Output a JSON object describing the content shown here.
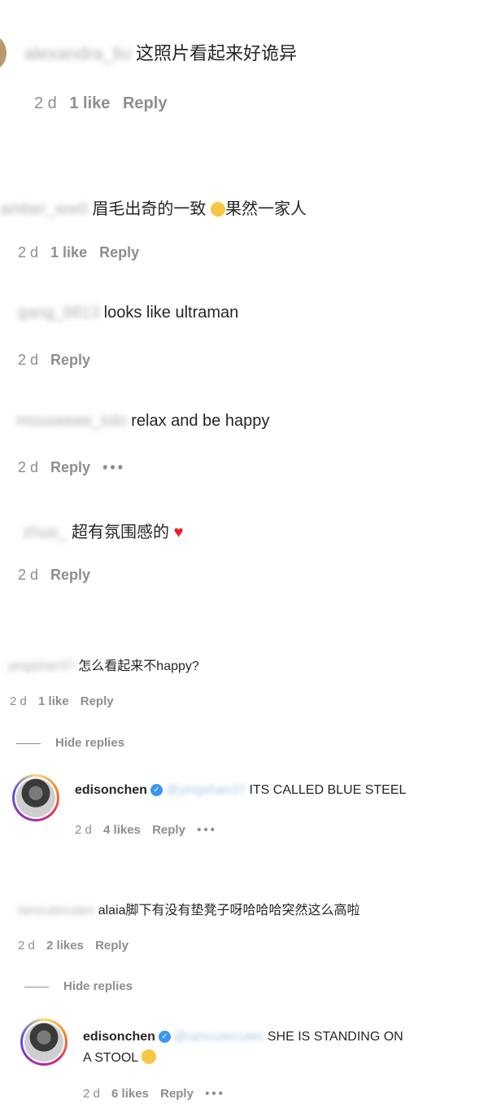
{
  "comments": [
    {
      "user": "alexandra_liu",
      "text": " 这照片看起来好诡异",
      "time": "2 d",
      "likes": "1 like",
      "reply": "Reply"
    },
    {
      "user": "amber_ww0",
      "text": " 眉毛出奇的一致",
      "text2": "果然一家人",
      "time": "2 d",
      "likes": "1 like",
      "reply": "Reply"
    },
    {
      "user": "gang_0813",
      "text": " looks like ultraman",
      "time": "2 d",
      "reply": "Reply"
    },
    {
      "user": "mouseeee_lolo",
      "text": " relax and be happy",
      "time": "2 d",
      "reply": "Reply",
      "more": "•••"
    },
    {
      "user": "zhuo_",
      "text": " 超有氛围感的",
      "heart": "♥",
      "time": "2 d",
      "reply": "Reply"
    },
    {
      "user": "yingshan37",
      "text": " 怎么看起来不happy?",
      "time": "2 d",
      "likes": "1 like",
      "reply": "Reply",
      "hide": "Hide replies",
      "replies": [
        {
          "user": "edisonchen",
          "mention": "@yingshan37",
          "text": " ITS CALLED BLUE STEEL",
          "time": "2 d",
          "likes": "4 likes",
          "reply": "Reply",
          "more": "•••"
        }
      ]
    },
    {
      "user": "iamcutecutec",
      "text": " alaia脚下有没有垫凳子呀哈哈哈突然这么高啦",
      "time": "2 d",
      "likes": "2 likes",
      "reply": "Reply",
      "hide": "Hide replies",
      "replies": [
        {
          "user": "edisonchen",
          "mention": "@iamcutecutec",
          "text": " SHE IS STANDING ON",
          "text2": "A STOOL",
          "time": "2 d",
          "likes": "6 likes",
          "reply": "Reply",
          "more": "•••"
        }
      ]
    }
  ]
}
